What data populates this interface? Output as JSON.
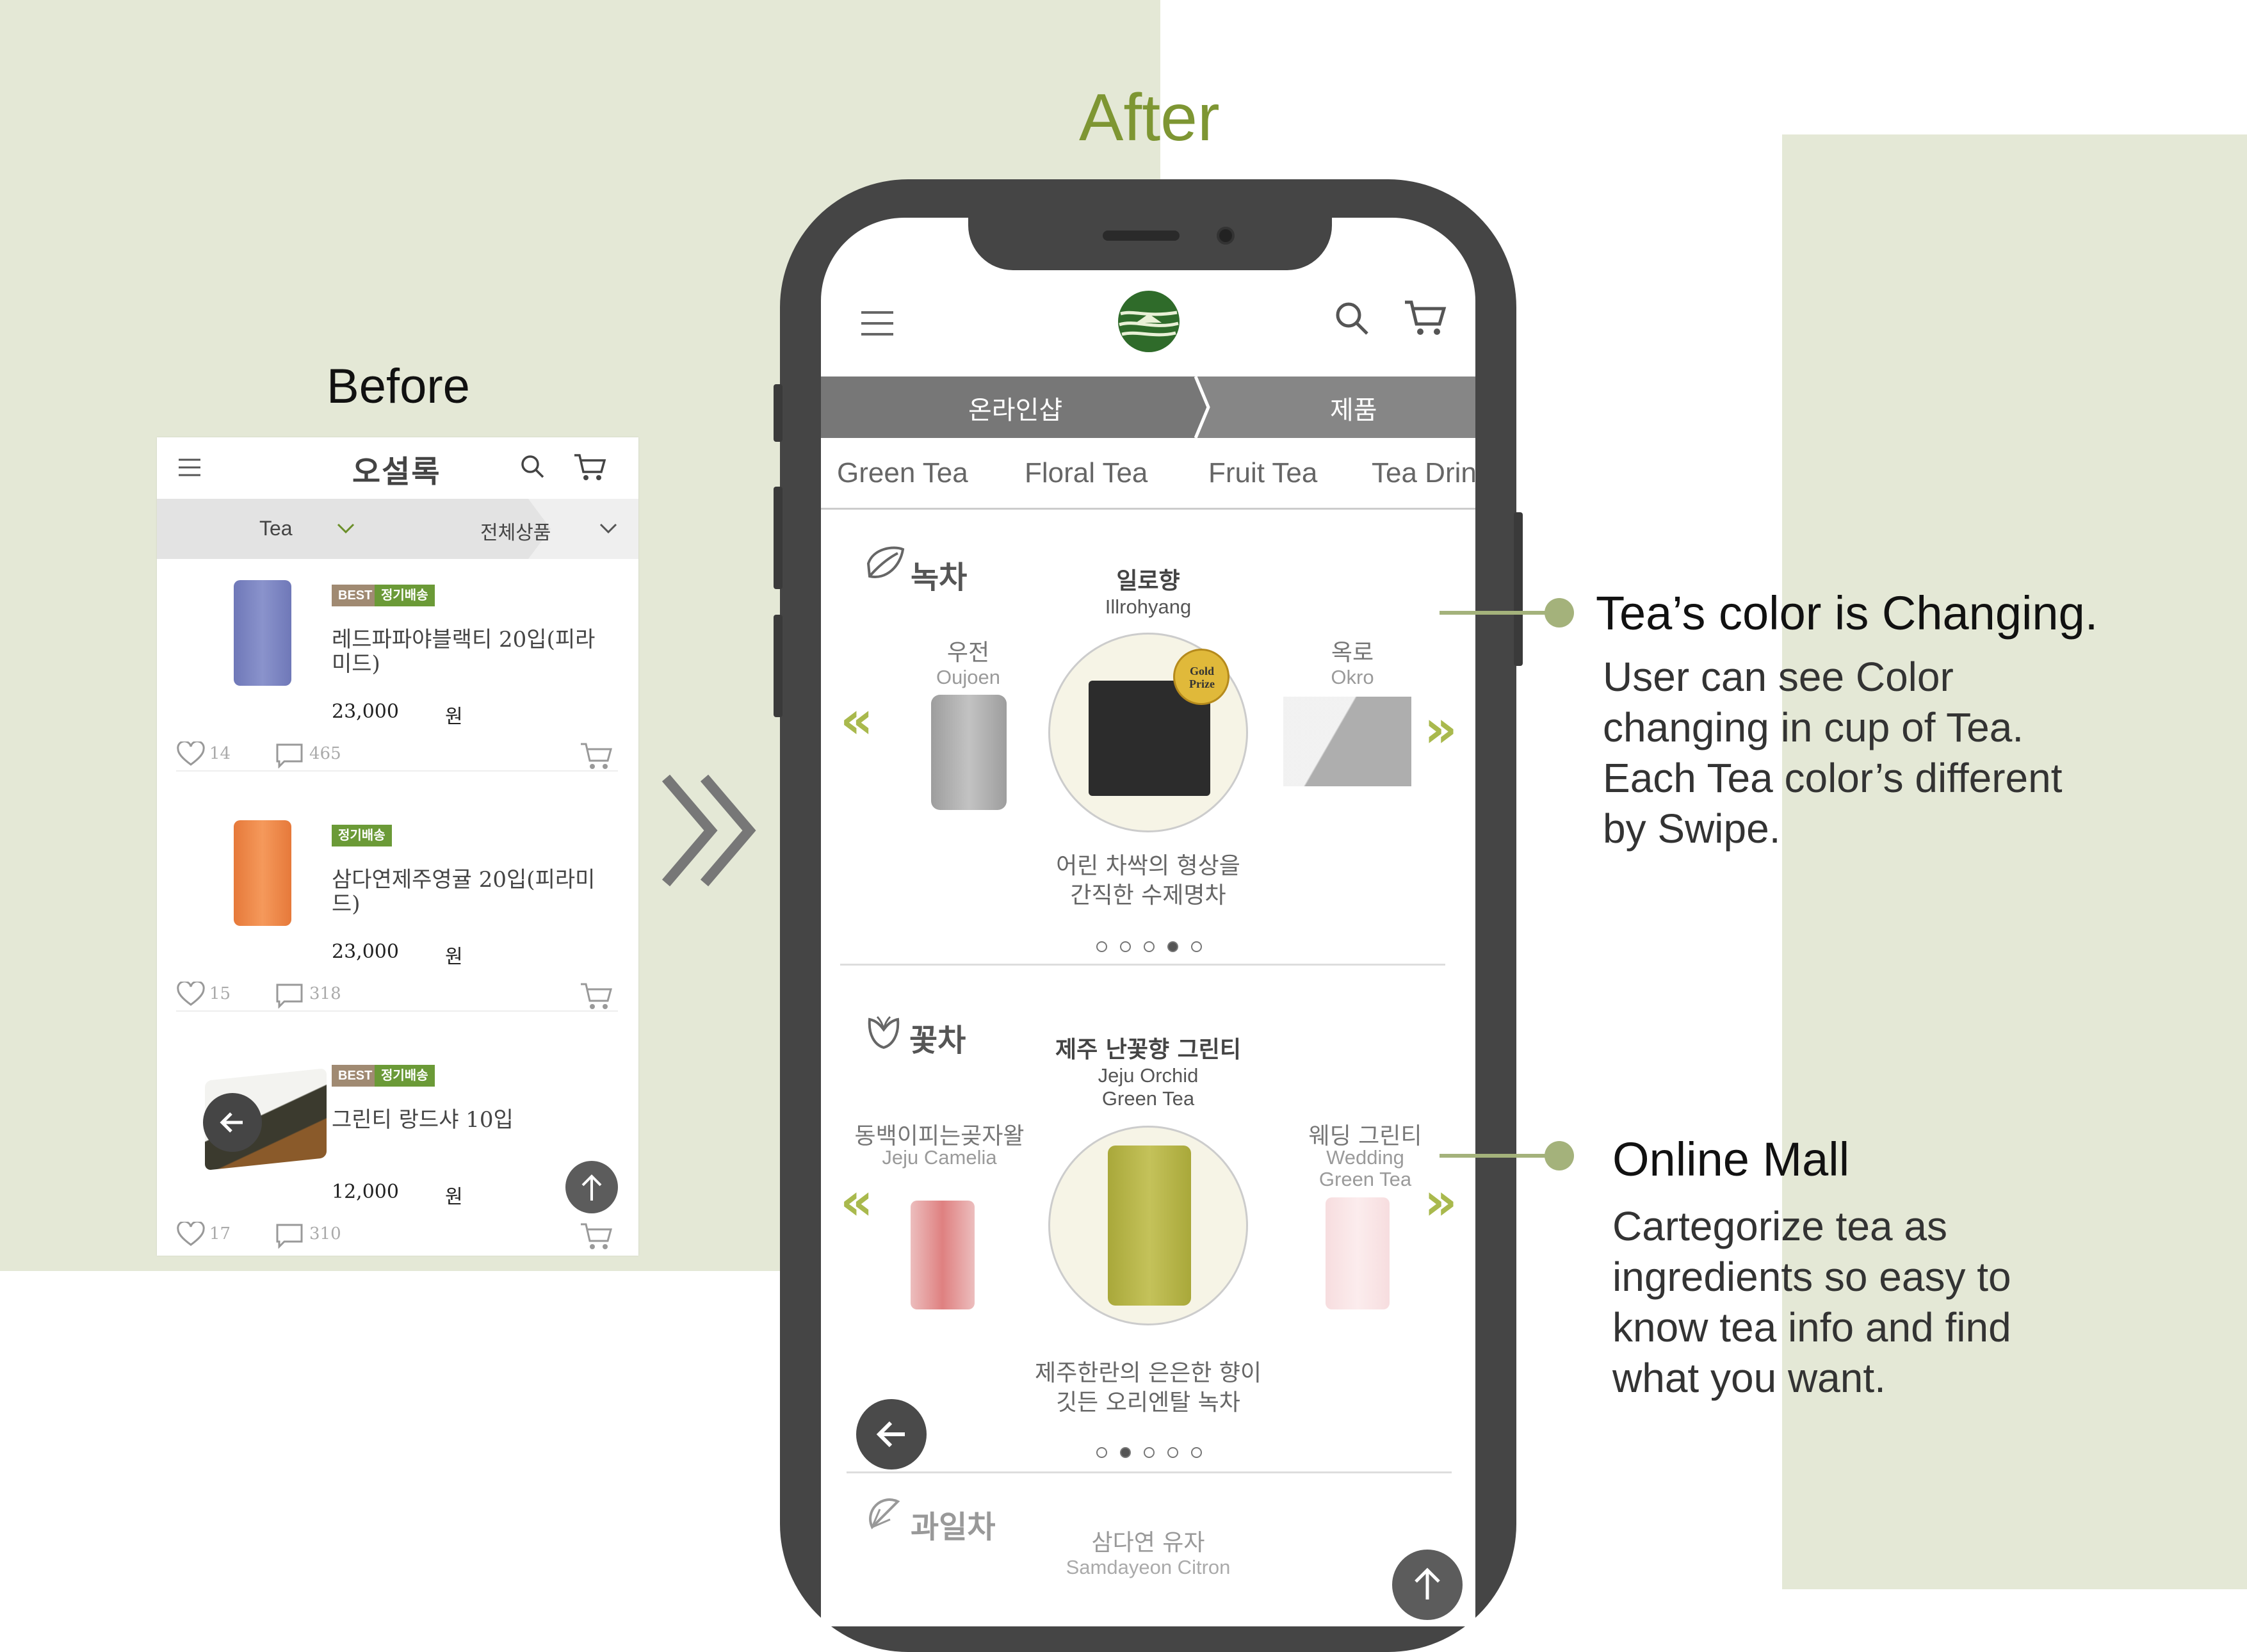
{
  "titles": {
    "before": "Before",
    "after": "After"
  },
  "colors": {
    "background_panel": "#e4e8d6",
    "accent_green": "#7e9633",
    "phone_body": "#454545",
    "tab_bar": "#777777"
  },
  "before": {
    "logo": "오설록",
    "filters": {
      "category": "Tea",
      "sub": "전체상품"
    },
    "products": [
      {
        "tags": [
          "BEST",
          "정기배송"
        ],
        "name": "레드파파야블랙티 20입(피라미드)",
        "price": "23,000",
        "unit": "원",
        "likes": "14",
        "comments": "465"
      },
      {
        "tags": [
          "정기배송"
        ],
        "name": "삼다연제주영귤 20입(피라미드)",
        "price": "23,000",
        "unit": "원",
        "likes": "15",
        "comments": "318"
      },
      {
        "tags": [
          "BEST",
          "정기배송"
        ],
        "name": "그린티 랑드샤 10입",
        "price": "12,000",
        "unit": "원",
        "likes": "17",
        "comments": "310"
      }
    ]
  },
  "after": {
    "breadcrumb": {
      "first": "온라인샵",
      "second": "제품"
    },
    "tabs": [
      "Green Tea",
      "Floral Tea",
      "Fruit Tea",
      "Tea Drin"
    ],
    "sections": [
      {
        "title": "녹차",
        "left": {
          "ko": "우전",
          "en": "Oujoen"
        },
        "center": {
          "ko": "일로향",
          "en": "Illrohyang",
          "desc_1": "어린 차싹의 형상을",
          "desc_2": "간직한 수제명차"
        },
        "right": {
          "ko": "옥로",
          "en": "Okro"
        },
        "active_dot": 4,
        "badge": "Gold Prize"
      },
      {
        "title": "꽃차",
        "left": {
          "ko": "동백이피는곶자왈",
          "en": "Jeju Camelia"
        },
        "center": {
          "ko": "제주 난꽃향 그린티",
          "en_1": "Jeju Orchid",
          "en_2": "Green Tea",
          "desc_1": "제주한란의 은은한 향이",
          "desc_2": "깃든 오리엔탈 녹차"
        },
        "right": {
          "ko": "웨딩 그린티",
          "en_1": "Wedding",
          "en_2": "Green Tea"
        },
        "active_dot": 2
      },
      {
        "title": "과일차",
        "center": {
          "ko": "삼다연 유자",
          "en": "Samdayeon Citron"
        }
      }
    ]
  },
  "annotations": [
    {
      "heading": "Tea’s color is Changing.",
      "lines": [
        "User can see Color",
        "changing in cup of Tea.",
        "Each Tea color’s different",
        "by Swipe."
      ]
    },
    {
      "heading": "Online Mall",
      "lines": [
        "Cartegorize tea as",
        "ingredients so easy to",
        "know tea info and find",
        "what you want."
      ]
    }
  ]
}
